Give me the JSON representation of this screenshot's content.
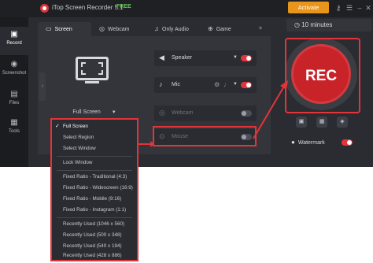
{
  "titlebar": {
    "title": "iTop Screen Recorder 5.1",
    "badge": "FREE",
    "activate_label": "Activate"
  },
  "sidebar": {
    "items": [
      {
        "label": "Record",
        "icon": "record-icon"
      },
      {
        "label": "Screenshot",
        "icon": "camera-icon"
      },
      {
        "label": "Files",
        "icon": "folder-icon"
      },
      {
        "label": "Tools",
        "icon": "tools-icon"
      }
    ]
  },
  "tabs": [
    {
      "label": "Screen",
      "icon": "monitor-icon"
    },
    {
      "label": "Webcam",
      "icon": "webcam-icon"
    },
    {
      "label": "Only Audio",
      "icon": "audio-icon"
    },
    {
      "label": "Game",
      "icon": "gamepad-icon"
    }
  ],
  "screen": {
    "selected": "Full Screen"
  },
  "controls": {
    "speaker": "Speaker",
    "mic": "Mic",
    "webcam": "Webcam",
    "mouse": "Mouse"
  },
  "timer": "10 minutes",
  "rec_label": "REC",
  "watermark_label": "Watermark",
  "dropdown": {
    "items": [
      "Full Screen",
      "Select Region",
      "Select Window",
      "Lock Window",
      "Fixed Ratio - Traditional (4:3)",
      "Fixed Ratio - Widescreen (16:9)",
      "Fixed Ratio - Mobile (9:16)",
      "Fixed Ratio - Instagram (1:1)",
      "Recently Used (1046 x 560)",
      "Recently Used (500 x 348)",
      "Recently Used (540 x 194)",
      "Recently Used (428 x 886)"
    ]
  },
  "colors": {
    "accent": "#e2343a",
    "activate": "#e8961b",
    "background": "#2a2c31"
  }
}
